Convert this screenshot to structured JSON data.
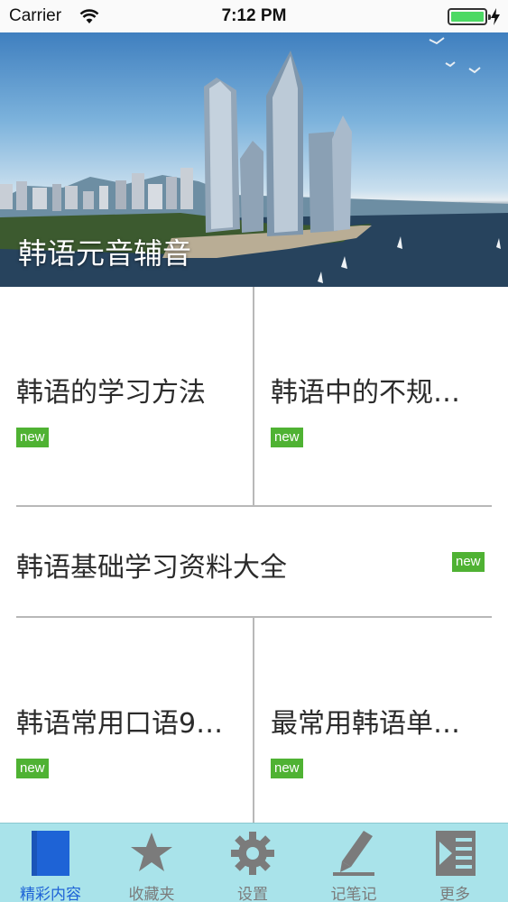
{
  "status_bar": {
    "carrier": "Carrier",
    "time": "7:12 PM",
    "battery_level": 1.0,
    "battery_color": "#4cd964"
  },
  "banner": {
    "title": "韩语元音辅音"
  },
  "cards": [
    {
      "title": "韩语的学习方法",
      "badge": "new"
    },
    {
      "title": "韩语中的不规…",
      "badge": "new"
    },
    {
      "title": "韩语基础学习资料大全",
      "badge": "new"
    },
    {
      "title": "韩语常用口语9…",
      "badge": "new"
    },
    {
      "title": "最常用韩语单…",
      "badge": "new"
    }
  ],
  "tabs": [
    {
      "label": "精彩内容",
      "icon": "book-icon",
      "active": true
    },
    {
      "label": "收藏夹",
      "icon": "star-icon",
      "active": false
    },
    {
      "label": "设置",
      "icon": "gear-icon",
      "active": false
    },
    {
      "label": "记笔记",
      "icon": "pen-icon",
      "active": false
    },
    {
      "label": "更多",
      "icon": "list-icon",
      "active": false
    }
  ],
  "colors": {
    "badge": "#4fb233",
    "tab_bar": "#a9e3ea",
    "tab_active": "#1e63d6",
    "tab_inactive": "#7b7b7b"
  }
}
